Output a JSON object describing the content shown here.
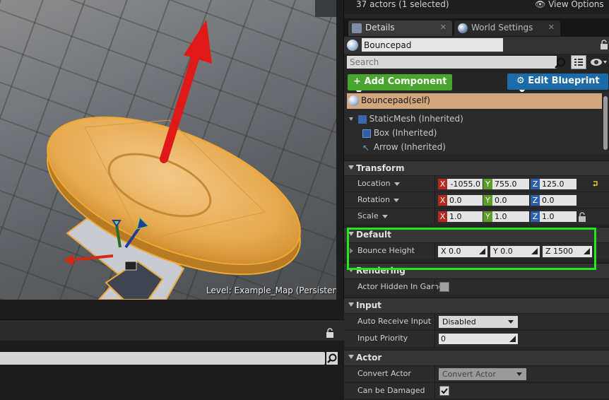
{
  "viewport": {
    "level_label": "Level:  Example_Map (Persistent)"
  },
  "outliner": {
    "actor_count": "37 actors (1 selected)",
    "view_options": "View Options"
  },
  "tabs": [
    {
      "label": "Details",
      "close": "✕"
    },
    {
      "label": "World Settings",
      "close": "✕"
    }
  ],
  "actor": {
    "name": "Bouncepad"
  },
  "search": {
    "placeholder": "Search"
  },
  "buttons": {
    "add_component": "Add Component",
    "edit_blueprint": "Edit Blueprint"
  },
  "components": {
    "self": "Bouncepad(self)",
    "items": [
      "StaticMesh (Inherited)",
      "Box (Inherited)",
      "Arrow (Inherited)"
    ]
  },
  "transform": {
    "category": "Transform",
    "location": {
      "label": "Location",
      "x": "-1055.0",
      "y": "755.0",
      "z": "125.0"
    },
    "rotation": {
      "label": "Rotation",
      "x": "0.0",
      "y": "0.0",
      "z": "0.0"
    },
    "scale": {
      "label": "Scale",
      "x": "1.0",
      "y": "1.0",
      "z": "1.0"
    }
  },
  "axes": {
    "x": "X",
    "y": "Y",
    "z": "Z"
  },
  "default": {
    "category": "Default",
    "bounce_height": {
      "label": "Bounce Height",
      "x": "X  0.0",
      "y": "Y  0.0",
      "z": "Z  1500"
    }
  },
  "rendering": {
    "category": "Rendering",
    "actor_hidden": {
      "label": "Actor Hidden In Game",
      "checked": false
    }
  },
  "input": {
    "category": "Input",
    "auto_receive": {
      "label": "Auto Receive Input",
      "value": "Disabled"
    },
    "priority": {
      "label": "Input Priority",
      "value": "0"
    }
  },
  "actor_section": {
    "category": "Actor",
    "convert": {
      "label": "Convert Actor",
      "value": "Convert Actor"
    },
    "damaged": {
      "label": "Can be Damaged",
      "checked": true
    }
  },
  "colors": {
    "highlight": "#27e51f",
    "add_component": "#4aa52e",
    "edit_blueprint": "#1c6ba8",
    "pad": "#e7a94e",
    "arrow": "#e01818"
  },
  "icons": [
    "lock-icon",
    "search-icon",
    "grid-icon",
    "eye-icon",
    "sphere-icon",
    "globe-icon",
    "reset-arrow-icon",
    "gear-icon"
  ]
}
